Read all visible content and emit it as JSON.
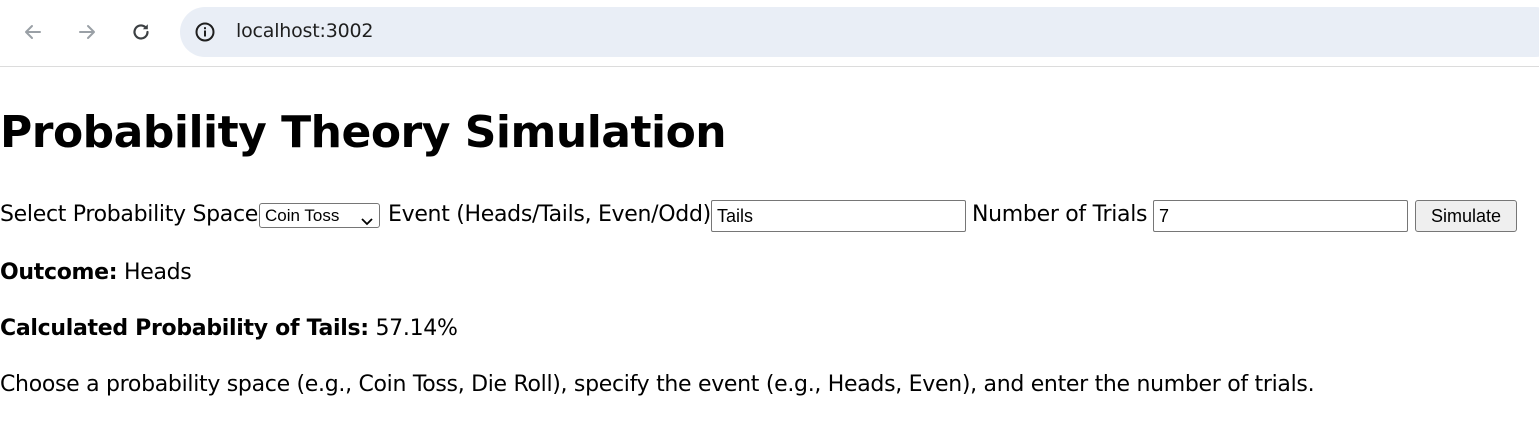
{
  "browser": {
    "url": "localhost:3002",
    "icons": [
      "back-arrow-icon",
      "forward-arrow-icon",
      "reload-icon",
      "info-icon"
    ]
  },
  "page": {
    "title": "Probability Theory Simulation",
    "controls": {
      "space_label": "Select Probability Space",
      "space_selected": "Coin Toss",
      "event_label": "Event (Heads/Tails, Even/Odd)",
      "event_value": "Tails",
      "trials_label": "Number of Trials",
      "trials_value": "7",
      "simulate_label": "Simulate"
    },
    "results": {
      "outcome_label": "Outcome:",
      "outcome_value": "Heads",
      "probability_label": "Calculated Probability of Tails:",
      "probability_value": "57.14%"
    },
    "instructions": "Choose a probability space (e.g., Coin Toss, Die Roll), specify the event (e.g., Heads, Even), and enter the number of trials."
  },
  "colors": {
    "omnibox_bg": "#e9eef6",
    "button_bg": "#efefef"
  }
}
